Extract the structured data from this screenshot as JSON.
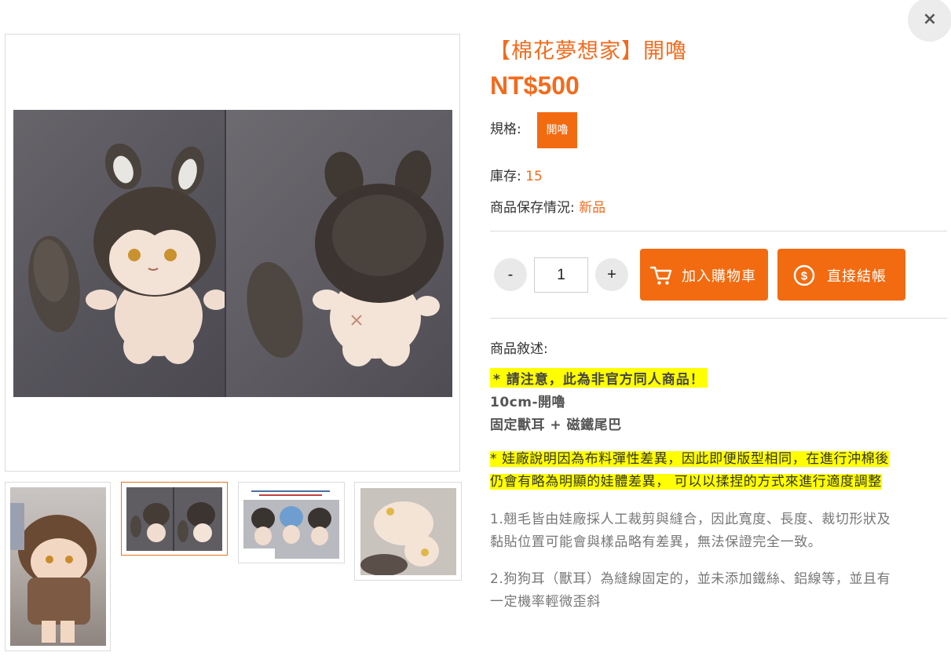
{
  "close_label": "×",
  "product": {
    "title": "【棉花夢想家】開嚕",
    "price": "NT$500",
    "spec_label": "規格:",
    "spec_option": "開嚕",
    "stock_label": "庫存:",
    "stock_value": "15",
    "condition_label": "商品保存情況:",
    "condition_value": "新品"
  },
  "purchase": {
    "minus": "-",
    "quantity": "1",
    "plus": "+",
    "add_to_cart": "加入購物車",
    "checkout": "直接結帳"
  },
  "description": {
    "label": "商品敘述:",
    "notice": "* 請注意，此為非官方同人商品！",
    "size": "10cm-開嚕",
    "parts": "固定獸耳 + 磁鐵尾巴",
    "factory_note_line1": "* 娃廠說明因為布料彈性差異，因此即便版型相同，在進行沖棉後",
    "factory_note_line2": "仍會有略為明顯的娃體差異， 可以以揉捏的方式來進行適度調整",
    "point1_line1": "1.翹毛皆由娃廠採人工裁剪與縫合，因此寬度、長度、裁切形狀及",
    "point1_line2": "黏貼位置可能會與樣品略有差異，無法保證完全一致。",
    "point2_line1": "2.狗狗耳（獸耳）為縫線固定的，並未添加鐵絲、鋁線等，並且有",
    "point2_line2": "一定機率輕微歪斜"
  },
  "colors": {
    "accent": "#f26b1d",
    "button": "#f26b10",
    "highlight": "#ffff00"
  },
  "icons": [
    "close-icon",
    "cart-icon",
    "dollar-coin-icon"
  ]
}
